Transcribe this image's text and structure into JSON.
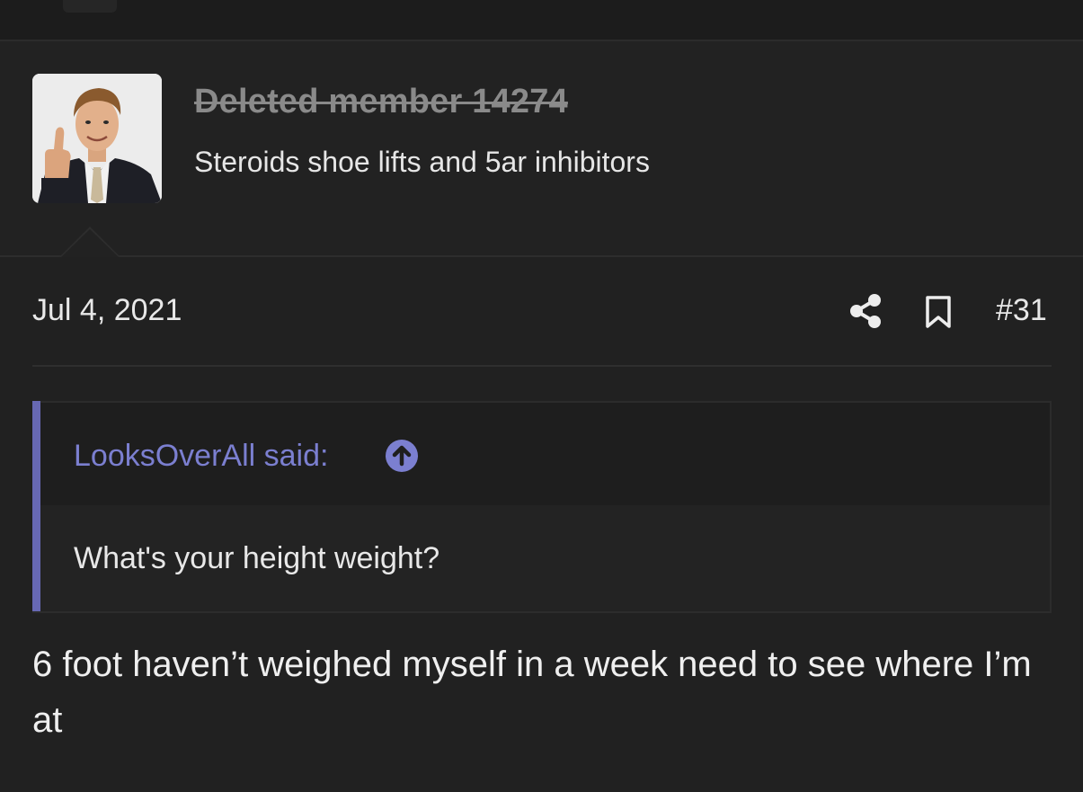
{
  "user": {
    "name": "Deleted member 14274",
    "title": "Steroids shoe lifts and 5ar inhibitors"
  },
  "post": {
    "date": "Jul 4, 2021",
    "number": "#31",
    "body": "6 foot haven’t weighed myself in a week need to see where I’m at"
  },
  "quote": {
    "author": "LooksOverAll said:",
    "text": "What's your height weight?"
  },
  "icons": {
    "share": "share-icon",
    "bookmark": "bookmark-icon",
    "jump": "arrow-up-circle-icon"
  },
  "colors": {
    "background": "#212121",
    "accent": "#6768b3",
    "quote_author": "#7b7fd0"
  }
}
